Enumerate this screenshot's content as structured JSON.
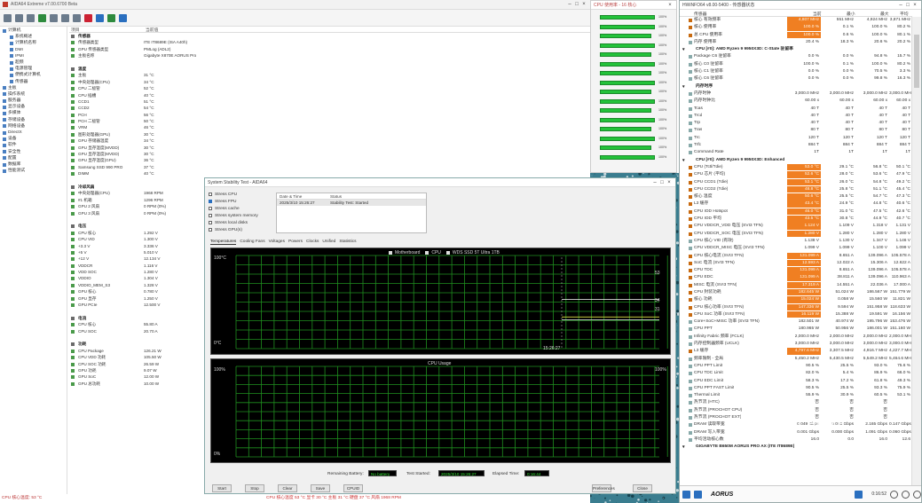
{
  "aida": {
    "title": "AIDA64 Extreme v7.00.6700 Beta",
    "columns": {
      "field": "项目",
      "value": "当前值"
    },
    "tree": [
      "计算机",
      "系统概述",
      "计算机名称",
      "DMI",
      "IPMI",
      "超频",
      "电源管理",
      "便携式计算机",
      "传感器",
      "主板",
      "操作系统",
      "服务器",
      "显示设备",
      "多媒体",
      "存储设备",
      "网络设备",
      "DirectX",
      "设备",
      "软件",
      "安全性",
      "配置",
      "数据库",
      "性能测试"
    ],
    "sections": [
      {
        "name": "传感器",
        "rows": [
          [
            "传感器类型",
            "ITE IT8689E  (ISA A40h)"
          ],
          [
            "GPU 传感器类型",
            "PMLog  (ADL2)"
          ],
          [
            "主板名称",
            "Gigabyte X870E AORUS Pro"
          ]
        ]
      },
      {
        "name": "温度",
        "rows": [
          [
            "主板",
            "31 °C"
          ],
          [
            "中央处理器(CPU)",
            "34 °C"
          ],
          [
            "CPU 二极管",
            "52 °C"
          ],
          [
            "CPU 插槽",
            "40 °C"
          ],
          [
            "CCD1",
            "51 °C"
          ],
          [
            "CCD2",
            "54 °C"
          ],
          [
            "PCH",
            "56 °C"
          ],
          [
            "PCH 二极管",
            "50 °C"
          ],
          [
            "VRM",
            "46 °C"
          ],
          [
            "图形处理器(GPU)",
            "30 °C"
          ],
          [
            "GPU 存储器温度",
            "34 °C"
          ],
          [
            "GPU 显存温度(MVDD)",
            "30 °C"
          ],
          [
            "GPU 显存温度(MVDD)",
            "30 °C"
          ],
          [
            "GPU 显存温度(GPU)",
            "36 °C"
          ],
          [
            "Samsung SSD 990 PRO",
            "37 °C"
          ],
          [
            "DIMM",
            "40 °C"
          ]
        ]
      },
      {
        "name": "冷却风扇",
        "rows": [
          [
            "中央处理器(CPU)",
            "1968 RPM"
          ],
          [
            "#1 机箱",
            "1296 RPM"
          ],
          [
            "GPU 2 风扇",
            "0 RPM (0%)"
          ],
          [
            "GPU 3 风扇",
            "0 RPM (0%)"
          ]
        ]
      },
      {
        "name": "电压",
        "rows": [
          [
            "CPU 核心",
            "1.292 V"
          ],
          [
            "CPU VID",
            "1.300 V"
          ],
          [
            "+3.3 V",
            "3.336 V"
          ],
          [
            "+5 V",
            "5.010 V"
          ],
          [
            "+12 V",
            "12.134 V"
          ],
          [
            "VDDCR",
            "1.116 V"
          ],
          [
            "VDD SOC",
            "1.280 V"
          ],
          [
            "VDDIO",
            "1.304 V"
          ],
          [
            "VDDIO_MEM_S3",
            "1.328 V"
          ],
          [
            "GPU 核心",
            "0.780 V"
          ],
          [
            "GPU 显存",
            "1.250 V"
          ],
          [
            "GPU PCIe",
            "12.500 V"
          ]
        ]
      },
      {
        "name": "电流",
        "rows": [
          [
            "CPU 核心",
            "55.80 A"
          ],
          [
            "CPU SOC",
            "20.70 A"
          ]
        ]
      },
      {
        "name": "功耗",
        "rows": [
          [
            "CPU Package",
            "126.21 W"
          ],
          [
            "CPU VDD 功耗",
            "105.50 W"
          ],
          [
            "CPU SOC 功耗",
            "26.59 W"
          ],
          [
            "GPU 功耗",
            "9.07 W"
          ],
          [
            "GPU SoC",
            "12.00 W"
          ],
          [
            "GPU 总功耗",
            "10.00 W"
          ]
        ]
      }
    ],
    "status": "CPU 核心温度: 53 °C"
  },
  "cpugraph": {
    "title": "CPU 使用率 - 16 核心",
    "bars": [
      1.0,
      1.0,
      0.93,
      1.0,
      0.93,
      1.0,
      0.93,
      1.0,
      0.93,
      1.0,
      0.93,
      1.0,
      0.93,
      1.0,
      0.93,
      1.0
    ],
    "labels": [
      "100%",
      "100%",
      "100%",
      "100%",
      "100%",
      "100%",
      "100%",
      "100%",
      "100%",
      "100%",
      "100%",
      "100%",
      "100%",
      "100%",
      "100%",
      "100%"
    ]
  },
  "hwinfo": {
    "title": "HWiNFO64 v8.00-5400 - 传感器状态",
    "columns": {
      "name": "传感器",
      "cur": "当前",
      "min": "最小",
      "max": "最大",
      "avg": "平均"
    },
    "rows": [
      {
        "t": "r",
        "n": "核心 有效频率",
        "c": "4,807 MHz",
        "mi": "551 MHz",
        "ma": "4,924 MHz",
        "av": "3,871 MHz",
        "o": true
      },
      {
        "t": "r",
        "n": "核心 使用率",
        "c": "100.0 %",
        "mi": "0.1 %",
        "ma": "100.0 %",
        "av": "80.2 %",
        "o": true
      },
      {
        "t": "r",
        "n": "总 CPU 使用率",
        "c": "100.0 %",
        "mi": "0.6 %",
        "ma": "100.0 %",
        "av": "80.1 %",
        "o": true
      },
      {
        "t": "r",
        "n": "内存 使用率",
        "c": "20.4 %",
        "mi": "18.3 %",
        "ma": "20.6 %",
        "av": "20.2 %",
        "o": false
      },
      {
        "t": "s",
        "n": "CPU [#0]: AMD Ryzen 9 9950X3D: C-State 驻留率"
      },
      {
        "t": "r",
        "n": "Package C6 驻留率",
        "c": "0.0 %",
        "mi": "0.0 %",
        "ma": "94.8 %",
        "av": "15.7 %",
        "o": false
      },
      {
        "t": "r",
        "n": "核心 C0 驻留率",
        "c": "100.0 %",
        "mi": "0.1 %",
        "ma": "100.0 %",
        "av": "80.2 %",
        "o": false
      },
      {
        "t": "r",
        "n": "核心 C1 驻留率",
        "c": "0.0 %",
        "mi": "0.0 %",
        "ma": "70.5 %",
        "av": "3.3 %",
        "o": false
      },
      {
        "t": "r",
        "n": "核心 C6 驻留率",
        "c": "0.0 %",
        "mi": "0.0 %",
        "ma": "99.8 %",
        "av": "16.3 %",
        "o": false
      },
      {
        "t": "s",
        "n": "内存时序"
      },
      {
        "t": "r",
        "n": "内存时钟",
        "c": "3,000.0 MHz",
        "mi": "3,000.0 MHz",
        "ma": "3,000.0 MHz",
        "av": "3,000.0 MHz",
        "o": false
      },
      {
        "t": "r",
        "n": "内存时钟比",
        "c": "60.00 x",
        "mi": "60.00 x",
        "ma": "60.00 x",
        "av": "60.00 x",
        "o": false
      },
      {
        "t": "r",
        "n": "Tcas",
        "c": "40 T",
        "mi": "40 T",
        "ma": "40 T",
        "av": "40 T",
        "o": false
      },
      {
        "t": "r",
        "n": "Trcd",
        "c": "40 T",
        "mi": "40 T",
        "ma": "40 T",
        "av": "40 T",
        "o": false
      },
      {
        "t": "r",
        "n": "Trp",
        "c": "40 T",
        "mi": "40 T",
        "ma": "40 T",
        "av": "40 T",
        "o": false
      },
      {
        "t": "r",
        "n": "Tras",
        "c": "80 T",
        "mi": "80 T",
        "ma": "80 T",
        "av": "80 T",
        "o": false
      },
      {
        "t": "r",
        "n": "Trc",
        "c": "120 T",
        "mi": "120 T",
        "ma": "120 T",
        "av": "120 T",
        "o": false
      },
      {
        "t": "r",
        "n": "Trfc",
        "c": "884 T",
        "mi": "884 T",
        "ma": "884 T",
        "av": "884 T",
        "o": false
      },
      {
        "t": "r",
        "n": "Command Rate",
        "c": "1T",
        "mi": "1T",
        "ma": "1T",
        "av": "1T",
        "o": false
      },
      {
        "t": "s",
        "n": "CPU [#0]: AMD Ryzen 9 9950X3D: Enhanced"
      },
      {
        "t": "r",
        "n": "CPU (Tctl/Tdie)",
        "c": "53.0 °C",
        "mi": "29.1 °C",
        "ma": "56.8 °C",
        "av": "50.1 °C",
        "o": true
      },
      {
        "t": "r",
        "n": "CPU 芯片 (平均)",
        "c": "52.6 °C",
        "mi": "28.0 °C",
        "ma": "53.6 °C",
        "av": "47.9 °C",
        "o": true
      },
      {
        "t": "r",
        "n": "CPU CCD1 (Tdie)",
        "c": "53.1 °C",
        "mi": "26.0 °C",
        "ma": "54.8 °C",
        "av": "49.2 °C",
        "o": true
      },
      {
        "t": "r",
        "n": "CPU CCD2 (Tdie)",
        "c": "48.8 °C",
        "mi": "25.8 °C",
        "ma": "51.1 °C",
        "av": "45.4 °C",
        "o": true
      },
      {
        "t": "r",
        "n": "核心 温度",
        "c": "50.6 °C",
        "mi": "25.5 °C",
        "ma": "54.7 °C",
        "av": "47.3 °C",
        "o": true
      },
      {
        "t": "r",
        "n": "L3 缓存",
        "c": "43.4 °C",
        "mi": "24.9 °C",
        "ma": "44.8 °C",
        "av": "40.6 °C",
        "o": true
      },
      {
        "t": "r",
        "n": "CPU IOD Hotspot",
        "c": "46.0 °C",
        "mi": "31.0 °C",
        "ma": "47.5 °C",
        "av": "42.6 °C",
        "o": true
      },
      {
        "t": "r",
        "n": "CPU IOD 平均",
        "c": "43.5 °C",
        "mi": "30.8 °C",
        "ma": "44.9 °C",
        "av": "40.7 °C",
        "o": true
      },
      {
        "t": "r",
        "n": "CPU VDDCR_VDD 电压 (SVI3 TFN)",
        "c": "1.124 V",
        "mi": "1.109 V",
        "ma": "1.318 V",
        "av": "1.131 V",
        "o": true
      },
      {
        "t": "r",
        "n": "CPU VDDCR_SOC 电压 (SVI3 TFN)",
        "c": "1.280 V",
        "mi": "1.280 V",
        "ma": "1.280 V",
        "av": "1.280 V",
        "o": true
      },
      {
        "t": "r",
        "n": "CPU 核心 VID (有效)",
        "c": "1.138 V",
        "mi": "1.130 V",
        "ma": "1.347 V",
        "av": "1.146 V",
        "o": false
      },
      {
        "t": "r",
        "n": "CPU VDDCR_MISC 电压 (SVI3 TFN)",
        "c": "1.099 V",
        "mi": "1.099 V",
        "ma": "1.100 V",
        "av": "1.099 V",
        "o": false
      },
      {
        "t": "r",
        "n": "CPU 核心电流 (SVI3 TFN)",
        "c": "131.099 A",
        "mi": "8.651 A",
        "ma": "139.096 A",
        "av": "105.578 A",
        "o": true
      },
      {
        "t": "r",
        "n": "SoC 电流 (SVI3 TFN)",
        "c": "12.593 A",
        "mi": "12.022 A",
        "ma": "15.306 A",
        "av": "12.622 A",
        "o": true
      },
      {
        "t": "r",
        "n": "CPU TDC",
        "c": "131.099 A",
        "mi": "8.651 A",
        "ma": "139.096 A",
        "av": "105.578 A",
        "o": true
      },
      {
        "t": "r",
        "n": "CPU EDC",
        "c": "131.099 A",
        "mi": "38.811 A",
        "ma": "139.096 A",
        "av": "110.963 A",
        "o": true
      },
      {
        "t": "r",
        "n": "MISC 电流 (SVI3 TFN)",
        "c": "17.319 A",
        "mi": "14.551 A",
        "ma": "22.036 A",
        "av": "17.000 A",
        "o": true
      },
      {
        "t": "r",
        "n": "CPU 封装功耗",
        "c": "182.645 W",
        "mi": "51.024 W",
        "ma": "186.567 W",
        "av": "151.779 W",
        "o": true
      },
      {
        "t": "r",
        "n": "核心 功耗",
        "c": "15.024 W",
        "mi": "0.058 W",
        "ma": "15.560 W",
        "av": "11.821 W",
        "o": true
      },
      {
        "t": "r",
        "n": "CPU 核心功率 (SVI3 TFN)",
        "c": "147.336 W",
        "mi": "9.594 W",
        "ma": "151.958 W",
        "av": "118.633 W",
        "o": true
      },
      {
        "t": "r",
        "n": "CPU SoC 功率 (SVI3 TFN)",
        "c": "16.119 W",
        "mi": "15.388 W",
        "ma": "19.591 W",
        "av": "16.156 W",
        "o": true
      },
      {
        "t": "r",
        "n": "Core+SoC+MISC 功率 (SVI3 TFN)",
        "c": "182.501 W",
        "mi": "40.974 W",
        "ma": "195.796 W",
        "av": "153.476 W",
        "o": false
      },
      {
        "t": "r",
        "n": "CPU PPT",
        "c": "180.965 W",
        "mi": "50.956 W",
        "ma": "186.001 W",
        "av": "151.160 W",
        "o": false
      },
      {
        "t": "r",
        "n": "Infinity Fabric 频率 (FCLK)",
        "c": "2,000.0 MHz",
        "mi": "2,000.0 MHz",
        "ma": "2,000.0 MHz",
        "av": "2,000.0 MHz",
        "o": false
      },
      {
        "t": "r",
        "n": "内存控制器频率 (UCLK)",
        "c": "3,000.0 MHz",
        "mi": "3,000.0 MHz",
        "ma": "3,000.0 MHz",
        "av": "3,000.0 MHz",
        "o": false
      },
      {
        "t": "r",
        "n": "L3 缓存",
        "c": "4,797.6 MHz",
        "mi": "3,307.5 MHz",
        "ma": "4,916.7 MHz",
        "av": "4,227.7 MHz",
        "o": true
      },
      {
        "t": "r",
        "n": "频率限制 - 全局",
        "c": "5,450.2 MHz",
        "mi": "5,430.5 MHz",
        "ma": "5,549.2 MHz",
        "av": "5,464.6 MHz",
        "o": false
      },
      {
        "t": "r",
        "n": "CPU PPT Limit",
        "c": "90.5 %",
        "mi": "25.5 %",
        "ma": "93.0 %",
        "av": "75.6 %",
        "o": false
      },
      {
        "t": "r",
        "n": "CPU TDC Limit",
        "c": "82.0 %",
        "mi": "5.4 %",
        "ma": "86.9 %",
        "av": "66.0 %",
        "o": false
      },
      {
        "t": "r",
        "n": "CPU EDC Limit",
        "c": "58.3 %",
        "mi": "17.2 %",
        "ma": "61.8 %",
        "av": "49.3 %",
        "o": false
      },
      {
        "t": "r",
        "n": "CPU PPT FAST Limit",
        "c": "90.5 %",
        "mi": "25.5 %",
        "ma": "93.3 %",
        "av": "75.9 %",
        "o": false
      },
      {
        "t": "r",
        "n": "Thermal Limit",
        "c": "55.9 %",
        "mi": "30.9 %",
        "ma": "60.5 %",
        "av": "53.1 %",
        "o": false
      },
      {
        "t": "r",
        "n": "热节流 (HTC)",
        "c": "否",
        "mi": "否",
        "ma": "否",
        "av": "",
        "o": false
      },
      {
        "t": "r",
        "n": "热节流 (PROCHOT CPU)",
        "c": "否",
        "mi": "否",
        "ma": "否",
        "av": "",
        "o": false
      },
      {
        "t": "r",
        "n": "热节流 (PROCHOT EXT)",
        "c": "否",
        "mi": "否",
        "ma": "否",
        "av": "",
        "o": false
      },
      {
        "t": "r",
        "n": "DRAM 读取带宽",
        "c": "0.049 Gbps",
        "mi": "0.000 Gbps",
        "ma": "2.165 Gbps",
        "av": "0.147 Gbps",
        "o": false
      },
      {
        "t": "r",
        "n": "DRAM 写入带宽",
        "c": "0.001 Gbps",
        "mi": "0.000 Gbps",
        "ma": "1.091 Gbps",
        "av": "0.060 Gbps",
        "o": false
      },
      {
        "t": "r",
        "n": "平均活动核心数",
        "c": "16.0",
        "mi": "0.0",
        "ma": "16.0",
        "av": "12.6",
        "o": false
      },
      {
        "t": "s",
        "n": "GIGABYTE B650M AORUS PRO AX (ITE IT8689E)"
      }
    ],
    "footer": {
      "time": "0:16:52",
      "logo": "AORUS"
    }
  },
  "stress": {
    "title": "System Stability Test - AIDA64",
    "options": [
      {
        "label": "Stress CPU",
        "on": false
      },
      {
        "label": "Stress FPU",
        "on": true
      },
      {
        "label": "Stress cache",
        "on": false
      },
      {
        "label": "Stress system memory",
        "on": false
      },
      {
        "label": "Stress local disks",
        "on": false
      },
      {
        "label": "Stress GPU(s)",
        "on": false
      }
    ],
    "table": {
      "col1": "Date & Time",
      "col2": "Status",
      "row": {
        "c1": "2025/3/10 15:26:27",
        "c2": "Stability Test: Started"
      }
    },
    "tabs": [
      "Temperatures",
      "Cooling Fans",
      "Voltages",
      "Powers",
      "Clocks",
      "Unified",
      "Statistics"
    ],
    "graph1": {
      "legend": [
        "Motherboard",
        "CPU",
        "WDS SSD 5T Ultra 1TB"
      ],
      "ymax": "100°C",
      "ymin": "0°C",
      "time": "15:26:27",
      "v1": "53",
      "v2": "34",
      "v3": "31"
    },
    "graph2": {
      "title": "CPU Usage",
      "ymax": "100%",
      "ymin": "0%",
      "vr": "100%"
    },
    "bottom": {
      "battery_label": "Remaining Battery:",
      "battery": "No battery",
      "start_label": "Test Started:",
      "start": "2025/3/10 15:26:27",
      "elapsed_label": "Elapsed Time:",
      "elapsed": "0:16:44"
    },
    "buttons": [
      "Start",
      "Stop",
      "Clear",
      "Save",
      "CPUID",
      "Preferences",
      "Close"
    ]
  },
  "statusbar": "CPU 核心温度 53 °C  显卡 30 °C  主板 31 °C  硬盘 37 °C  风扇 1968 RPM",
  "watermark": {
    "brand": "PCHOME",
    "url": "WWW.PCHOME.NET"
  },
  "colors": {
    "hot": "#f07f22",
    "graph_green": "#23c23a",
    "graph_bg": "#000000"
  }
}
